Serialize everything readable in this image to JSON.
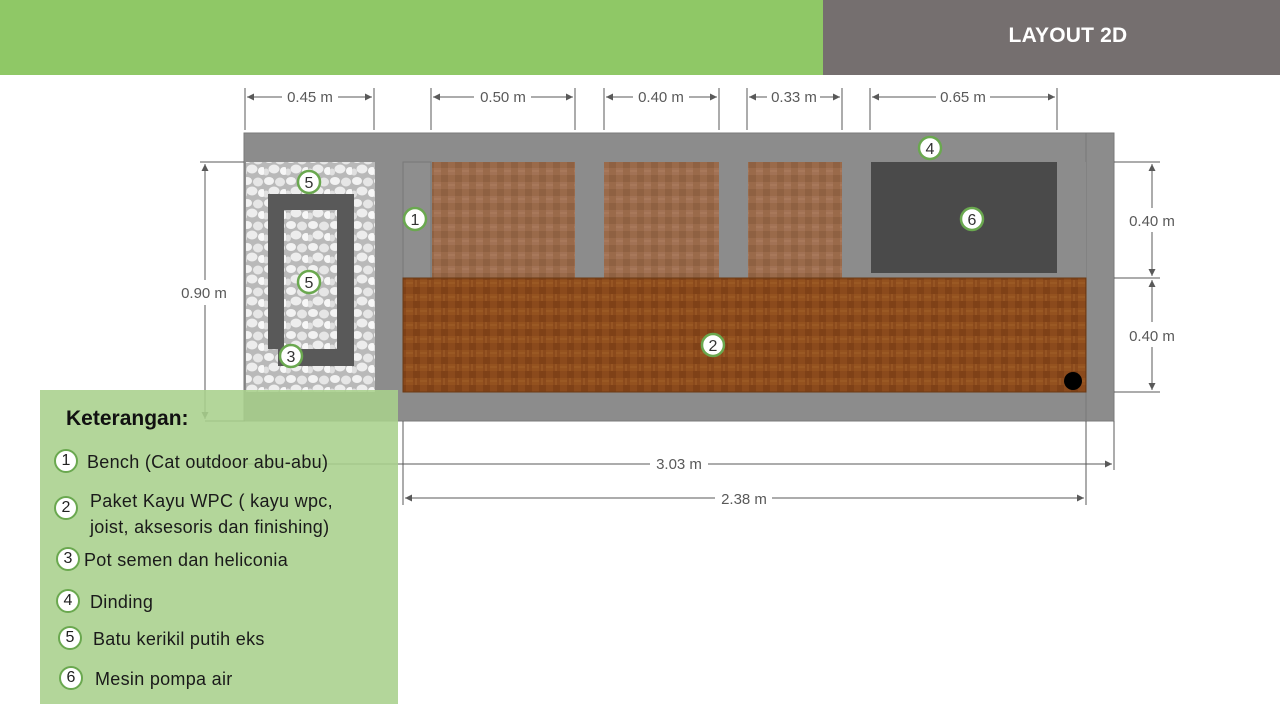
{
  "header": {
    "title": "LAYOUT 2D"
  },
  "dimensions": {
    "gravel_width": "0.45 m",
    "bay1": "0.50 m",
    "bay2": "0.40 m",
    "bay3": "0.33 m",
    "pump_bay": "0.65 m",
    "depth": "0.90 m",
    "upper_depth": "0.40 m",
    "lower_depth": "0.40 m",
    "total_width": "3.03 m",
    "deck_width": "2.38 m"
  },
  "markers": {
    "m1": "1",
    "m2": "2",
    "m3": "3",
    "m4": "4",
    "m5a": "5",
    "m5b": "5",
    "m6": "6"
  },
  "colors": {
    "header_green": "#8fc866",
    "header_gray": "#756f6f",
    "wall": "#8c8c8c",
    "deck_wood": "#8b4a1c",
    "pump": "#4a4a4a",
    "legend_bg": "#a8d08c",
    "badge_ring": "#6aa84f"
  },
  "legend": {
    "title": "Keterangan:",
    "items": [
      {
        "num": "1",
        "text": "Bench (Cat outdoor abu-abu)"
      },
      {
        "num": "2",
        "text": "Paket Kayu WPC ( kayu wpc,",
        "text2": "joist, aksesoris dan finishing)"
      },
      {
        "num": "3",
        "text": "Pot semen dan heliconia"
      },
      {
        "num": "4",
        "text": "Dinding"
      },
      {
        "num": "5",
        "text": "Batu kerikil putih eks"
      },
      {
        "num": "6",
        "text": "Mesin pompa air"
      }
    ]
  }
}
